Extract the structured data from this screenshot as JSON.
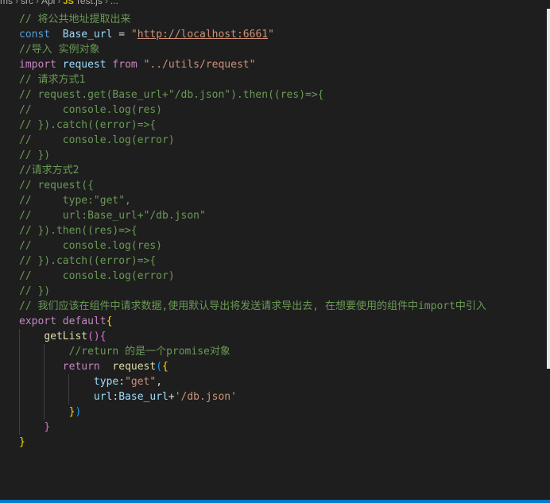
{
  "breadcrumb": {
    "items": [
      "ms",
      "src",
      "Api"
    ],
    "file_badge": "JS",
    "file_name": "Test.js",
    "trailing": "..."
  },
  "code_lines": [
    [
      {
        "t": "// 将公共地址提取出来",
        "c": "comment"
      }
    ],
    [
      {
        "t": "const",
        "c": "keyword"
      },
      {
        "t": "  ",
        "c": "op"
      },
      {
        "t": "Base_url",
        "c": "var"
      },
      {
        "t": " = ",
        "c": "op"
      },
      {
        "t": "\"",
        "c": "string"
      },
      {
        "t": "http://localhost:6661",
        "c": "string link"
      },
      {
        "t": "\"",
        "c": "string"
      }
    ],
    [
      {
        "t": "//导入 实例对象",
        "c": "comment"
      }
    ],
    [
      {
        "t": "import",
        "c": "control"
      },
      {
        "t": " ",
        "c": "op"
      },
      {
        "t": "request",
        "c": "var"
      },
      {
        "t": " ",
        "c": "op"
      },
      {
        "t": "from",
        "c": "control"
      },
      {
        "t": " ",
        "c": "op"
      },
      {
        "t": "\"../utils/request\"",
        "c": "string"
      }
    ],
    [
      {
        "t": "// 请求方式1",
        "c": "comment"
      }
    ],
    [
      {
        "t": "// request.get(Base_url+\"/db.json\").then((res)=>{",
        "c": "comment"
      }
    ],
    [
      {
        "t": "//     console.log(res)",
        "c": "comment"
      }
    ],
    [
      {
        "t": "// }).catch((error)=>{",
        "c": "comment"
      }
    ],
    [
      {
        "t": "//     console.log(error)",
        "c": "comment"
      }
    ],
    [
      {
        "t": "// })",
        "c": "comment"
      }
    ],
    [
      {
        "t": "//请求方式2",
        "c": "comment"
      }
    ],
    [
      {
        "t": "// request({",
        "c": "comment"
      }
    ],
    [
      {
        "t": "//     type:\"get\",",
        "c": "comment"
      }
    ],
    [
      {
        "t": "//     url:Base_url+\"/db.json\"",
        "c": "comment"
      }
    ],
    [
      {
        "t": "// }).then((res)=>{",
        "c": "comment"
      }
    ],
    [
      {
        "t": "//     console.log(res)",
        "c": "comment"
      }
    ],
    [
      {
        "t": "// }).catch((error)=>{",
        "c": "comment"
      }
    ],
    [
      {
        "t": "//     console.log(error)",
        "c": "comment"
      }
    ],
    [
      {
        "t": "// })",
        "c": "comment"
      }
    ],
    [
      {
        "t": "// 我们应该在组件中请求数据,使用默认导出将发送请求导出去, 在想要使用的组件中import中引入",
        "c": "comment"
      }
    ],
    [
      {
        "t": "export",
        "c": "control"
      },
      {
        "t": " ",
        "c": "op"
      },
      {
        "t": "default",
        "c": "control"
      },
      {
        "t": "{",
        "c": "brace1"
      }
    ],
    [
      {
        "t": "    ",
        "c": "op"
      },
      {
        "t": "getList",
        "c": "func"
      },
      {
        "t": "()",
        "c": "brace2"
      },
      {
        "t": "{",
        "c": "brace2"
      }
    ],
    [
      {
        "t": "        ",
        "c": "op"
      },
      {
        "t": "//return 的是一个promise对象",
        "c": "comment"
      }
    ],
    [
      {
        "t": "       ",
        "c": "op"
      },
      {
        "t": "return",
        "c": "control"
      },
      {
        "t": "  ",
        "c": "op"
      },
      {
        "t": "request",
        "c": "func"
      },
      {
        "t": "(",
        "c": "brace3"
      },
      {
        "t": "{",
        "c": "brace1"
      }
    ],
    [
      {
        "t": "            ",
        "c": "op"
      },
      {
        "t": "type",
        "c": "var"
      },
      {
        "t": ":",
        "c": "op"
      },
      {
        "t": "\"get\"",
        "c": "string"
      },
      {
        "t": ",",
        "c": "op"
      }
    ],
    [
      {
        "t": "            ",
        "c": "op"
      },
      {
        "t": "url",
        "c": "var"
      },
      {
        "t": ":",
        "c": "op"
      },
      {
        "t": "Base_url",
        "c": "var"
      },
      {
        "t": "+",
        "c": "op"
      },
      {
        "t": "'/db.json'",
        "c": "string"
      }
    ],
    [
      {
        "t": "        ",
        "c": "op"
      },
      {
        "t": "}",
        "c": "brace1"
      },
      {
        "t": ")",
        "c": "brace3"
      }
    ],
    [
      {
        "t": "    ",
        "c": "op"
      },
      {
        "t": "}",
        "c": "brace2"
      }
    ],
    [
      {
        "t": "}",
        "c": "brace1"
      }
    ]
  ]
}
